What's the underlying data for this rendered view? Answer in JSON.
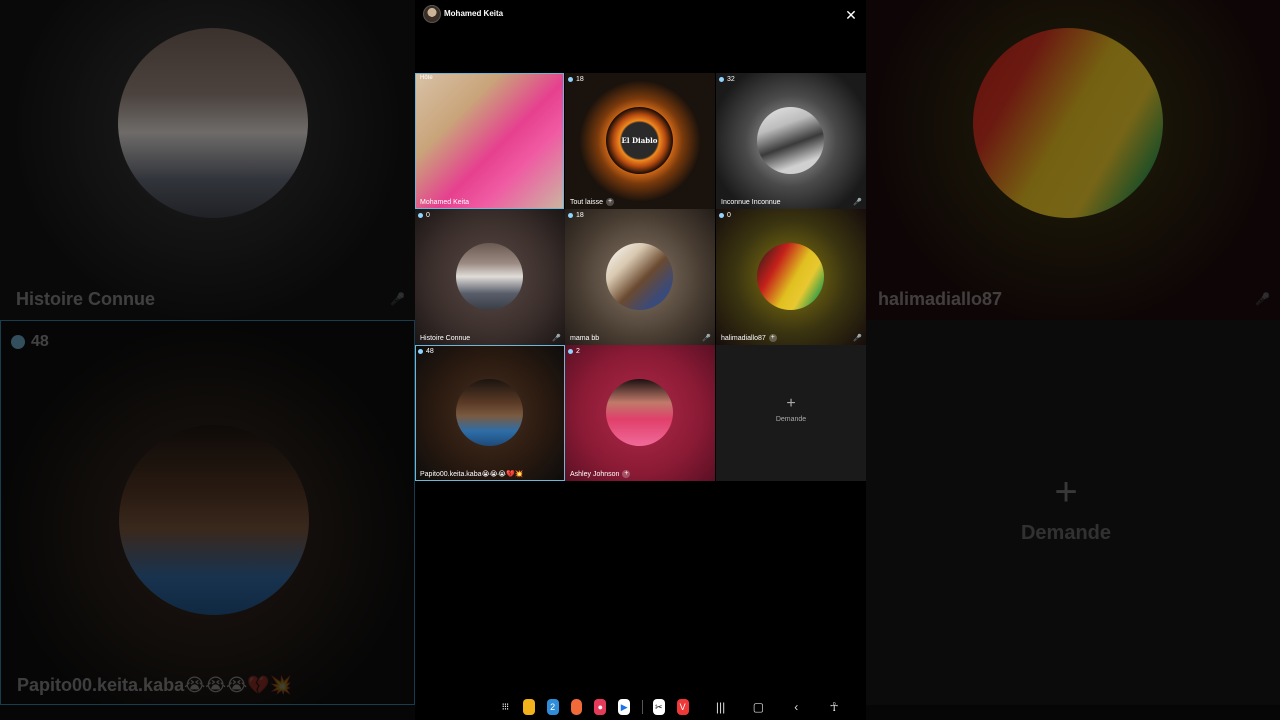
{
  "header": {
    "host_name": "Mohamed Keita",
    "close_icon": "close-icon"
  },
  "tiles": [
    {
      "name": "Mohamed Keita",
      "host_label": "Hôte"
    },
    {
      "name": "Tout laisse",
      "count": "18",
      "logo_text": "El Diablo"
    },
    {
      "name": "Inconnue Inconnue",
      "count": "32"
    },
    {
      "name": "Histoire Connue",
      "count": "0"
    },
    {
      "name": "mama bb",
      "count": "18"
    },
    {
      "name": "halimadiallo87",
      "count": "0"
    },
    {
      "name": "Papito00.keita.kaba😭😭😭💔💥",
      "count": "48"
    },
    {
      "name": "Ashley Johnson",
      "count": "2"
    }
  ],
  "demande": {
    "label": "Demande",
    "icon": "plus-icon"
  },
  "background": {
    "left_top_name": "Histoire Connue",
    "left_bottom_count": "48",
    "left_bottom_name": "Papito00.keita.kaba😭😭😭💔💥",
    "right_top_name": "halimadiallo87",
    "right_bottom_label": "Demande"
  },
  "taskbar": {
    "apps": [
      "apps-grid-icon",
      "files-icon",
      "calendar-icon",
      "contacts-icon",
      "camera-icon",
      "play-store-icon",
      "capcut-icon",
      "vivaldi-icon"
    ],
    "calendar_day": "2",
    "nav": [
      "recents-icon",
      "home-icon",
      "back-icon",
      "accessibility-icon"
    ]
  },
  "colors": {
    "selected_outline": "#6fb7d8",
    "count_dot": "#8fd3ff",
    "background": "#000000"
  }
}
